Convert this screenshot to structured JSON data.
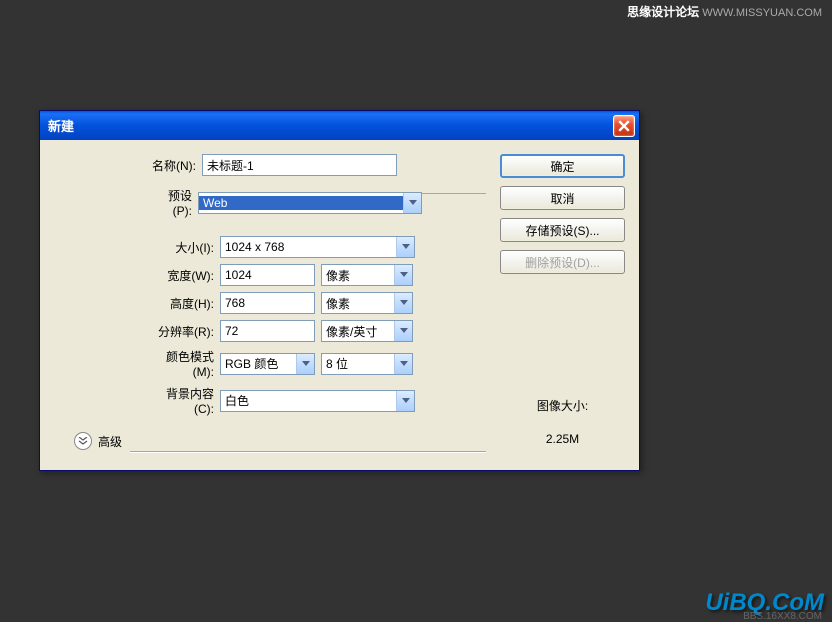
{
  "watermark": {
    "top_bold": "思缘设计论坛",
    "top_url": "WWW.MISSYUAN.COM",
    "bottom": "UiBQ.CoM",
    "sub": "BBS.16XX8.COM"
  },
  "dialog": {
    "title": "新建",
    "buttons": {
      "ok": "确定",
      "cancel": "取消",
      "save_preset": "存储预设(S)...",
      "delete_preset": "删除预设(D)..."
    },
    "labels": {
      "name": "名称(N):",
      "preset": "预设(P):",
      "size": "大小(I):",
      "width": "宽度(W):",
      "height": "高度(H):",
      "resolution": "分辨率(R):",
      "color_mode": "颜色模式(M):",
      "background": "背景内容(C):",
      "advanced": "高级",
      "image_size": "图像大小:"
    },
    "values": {
      "name": "未标题-1",
      "preset": "Web",
      "size": "1024 x 768",
      "width": "1024",
      "height": "768",
      "resolution": "72",
      "color_mode": "RGB 颜色",
      "bit_depth": "8 位",
      "background": "白色",
      "width_unit": "像素",
      "height_unit": "像素",
      "resolution_unit": "像素/英寸",
      "image_size": "2.25M"
    }
  }
}
